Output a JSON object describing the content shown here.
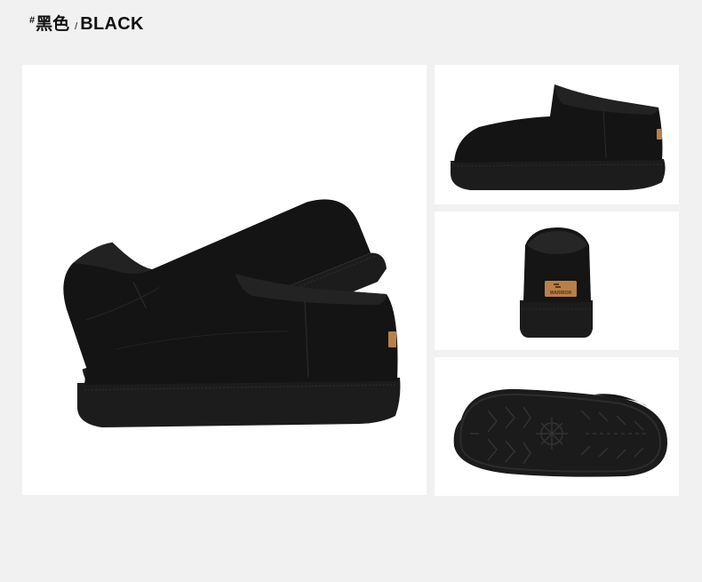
{
  "heading": {
    "hash": "#",
    "color_cn": "黑色",
    "separator": "/",
    "color_en": "BLACK"
  },
  "product": {
    "color": "#151515",
    "sole_color": "#1c1c1c",
    "heel_label_color": "#b8804a",
    "heel_label_text": "WARRIOR"
  },
  "views": [
    {
      "name": "pair-view"
    },
    {
      "name": "side-view"
    },
    {
      "name": "back-view"
    },
    {
      "name": "sole-view"
    }
  ]
}
